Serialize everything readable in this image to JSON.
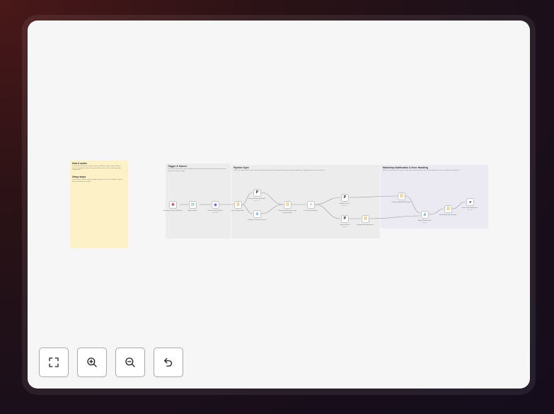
{
  "workflow": {
    "notes": [
      {
        "key": "how",
        "title": "How it works",
        "text": "This workflow keeps your pipeline and your CRM deal stages aligned. When a contact is updated, its data is merged and the deal is moved to the right stage automatically.",
        "color": "#fdf1c7"
      },
      {
        "key": "setup",
        "title": "Setup steps",
        "text": "Connect your accounts, map the pipeline stages and set the notification channel before activating the workflow.",
        "color": "#fdf1c7"
      },
      {
        "key": "trigger",
        "title": "Trigger & Source",
        "text": "This section watches for contact updates and fetches the latest record from the source before passing it to the sync stage.",
        "color": "#ececec"
      },
      {
        "key": "pipeline",
        "title": "Pipeline Sync",
        "text": "Stores the contact fields, searches for the matching deal by email, merges both records and either updates the existing deal or creates a new one.",
        "color": "#ececec"
      },
      {
        "key": "notify",
        "title": "Mailchimp Notification & Error Handling",
        "text": "Builds a summary of the changes, merges the notifications and sends a final notification; errors are collected and reported.",
        "color": "#ebeaf3"
      }
    ],
    "nodes": [
      {
        "key": "trigger",
        "label": "Incoming Contact Webhook",
        "icon": "webhook-icon",
        "glyph": "✱",
        "color": "#c4374d"
      },
      {
        "key": "split",
        "label": "Split Contacts",
        "icon": "loop-icon",
        "glyph": "⟳",
        "color": "#28a06b"
      },
      {
        "key": "fetch",
        "label": "Fetch Contact Details",
        "sub": "from CRM",
        "icon": "crm-icon",
        "glyph": "◉",
        "color": "#6b55c8"
      },
      {
        "key": "store",
        "label": "Store Contact Data",
        "icon": "code-icon",
        "glyph": "{}",
        "color": "#f0a020"
      },
      {
        "key": "search",
        "label": "Search Person by Email",
        "sub": "pipedrive",
        "icon": "pipedrive-icon",
        "glyph": "P",
        "color": "#1a1a1a"
      },
      {
        "key": "combine",
        "label": "Combine Contact & Search",
        "icon": "merge-icon",
        "glyph": "⋔",
        "color": "#2f8fd6"
      },
      {
        "key": "prepare",
        "label": "Check Deal Existence and Prepare Data",
        "icon": "code-icon",
        "glyph": "{}",
        "color": "#f0a020"
      },
      {
        "key": "exists",
        "label": "Is Person Existing?",
        "icon": "if-icon",
        "glyph": "⑂",
        "color": "#26a49a"
      },
      {
        "key": "update",
        "label": "Update Person",
        "sub": "pipedrive",
        "icon": "pipedrive-icon",
        "glyph": "P",
        "color": "#1a1a1a"
      },
      {
        "key": "create",
        "label": "Create Person",
        "sub": "pipedrive",
        "icon": "pipedrive-icon",
        "glyph": "P",
        "color": "#1a1a1a"
      },
      {
        "key": "prepnew",
        "label": "Prepare New Notification",
        "icon": "code-icon",
        "glyph": "{}",
        "color": "#f0a020"
      },
      {
        "key": "prepupd",
        "label": "Prepare Update Notification",
        "icon": "code-icon",
        "glyph": "{}",
        "color": "#f0a020"
      },
      {
        "key": "merge",
        "label": "Merge Notifications",
        "sub": "append",
        "icon": "merge-icon",
        "glyph": "⋔",
        "color": "#2f8fd6"
      },
      {
        "key": "build",
        "label": "Build Mailchimp Payload",
        "icon": "code-icon",
        "glyph": "{}",
        "color": "#f0a020"
      },
      {
        "key": "send",
        "label": "Send Team Notification",
        "sub": "mailchimp",
        "icon": "mailchimp-icon",
        "glyph": "◕",
        "color": "#1a1a1a"
      }
    ]
  },
  "controls": [
    {
      "key": "fit",
      "icon": "fit-to-view-icon"
    },
    {
      "key": "zoom_in",
      "icon": "zoom-in-icon"
    },
    {
      "key": "zoom_out",
      "icon": "zoom-out-icon"
    },
    {
      "key": "undo",
      "icon": "undo-icon"
    }
  ],
  "colors": {
    "canvas": "#f6f6f6",
    "control_border": "#a9a9a9",
    "wire": "#9a9a9a"
  }
}
